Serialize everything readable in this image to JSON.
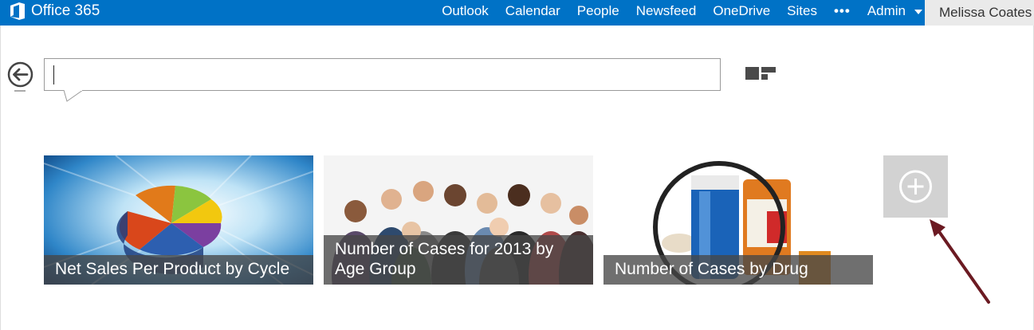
{
  "header": {
    "brand": "Office 365",
    "nav": [
      "Outlook",
      "Calendar",
      "People",
      "Newsfeed",
      "OneDrive",
      "Sites"
    ],
    "more": "•••",
    "admin": "Admin",
    "user": "Melissa Coates"
  },
  "search": {
    "value": "",
    "placeholder": ""
  },
  "tiles": [
    {
      "caption": "Net Sales Per Product by Cycle"
    },
    {
      "caption": "Number of Cases for 2013 by Age Group"
    },
    {
      "caption": "Number of Cases by Drug"
    }
  ],
  "icons": {
    "brand": "office-logo-icon",
    "back": "back-arrow-icon",
    "layout": "layout-toggle-icon",
    "add": "plus-circle-icon",
    "annotation": "arrow-annotation"
  },
  "colors": {
    "topbar": "#0072c6",
    "user_bg": "#eaeaea",
    "add_tile": "#d2d2d2",
    "arrow": "#6b1a22"
  }
}
